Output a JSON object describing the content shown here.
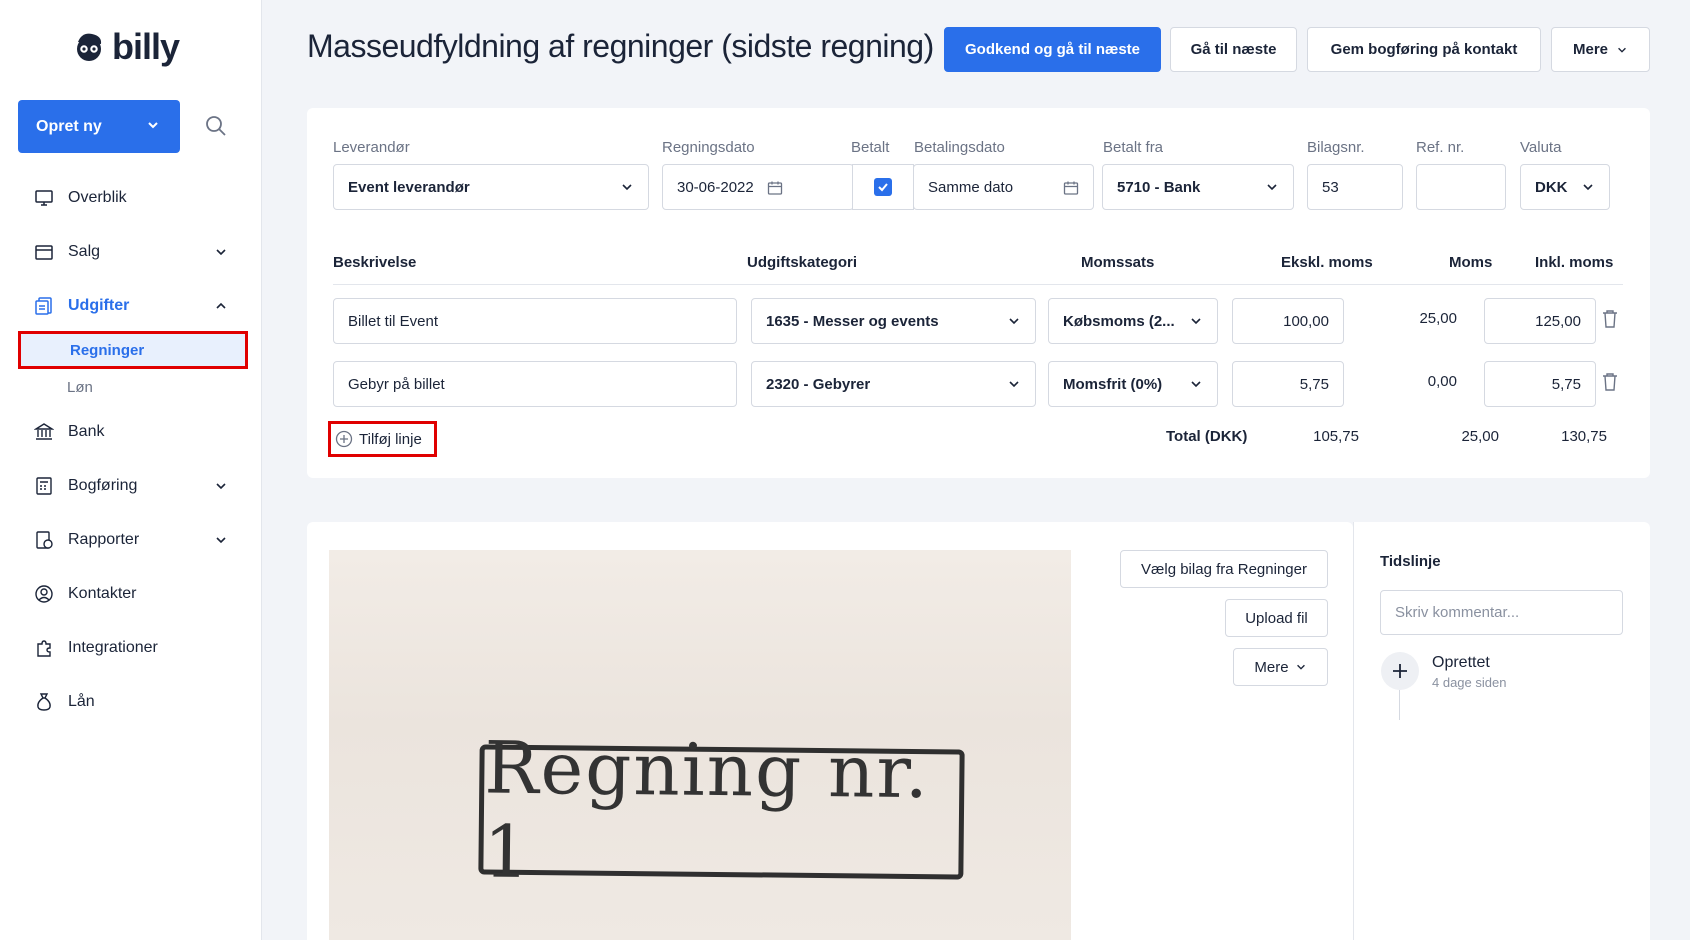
{
  "brand": {
    "name": "billy"
  },
  "sidebar": {
    "create_label": "Opret ny",
    "items": [
      {
        "label": "Overblik"
      },
      {
        "label": "Salg"
      },
      {
        "label": "Udgifter"
      },
      {
        "label": "Regninger"
      },
      {
        "label": "Løn"
      },
      {
        "label": "Bank"
      },
      {
        "label": "Bogføring"
      },
      {
        "label": "Rapporter"
      },
      {
        "label": "Kontakter"
      },
      {
        "label": "Integrationer"
      },
      {
        "label": "Lån"
      }
    ]
  },
  "header": {
    "title": "Masseudfyldning af regninger (sidste regning)",
    "approve_label": "Godkend og gå til næste",
    "next_label": "Gå til næste",
    "save_posting_label": "Gem bogføring på kontakt",
    "more_label": "Mere"
  },
  "bill": {
    "labels": {
      "supplier": "Leverandør",
      "bill_date": "Regningsdato",
      "paid": "Betalt",
      "payment_date": "Betalingsdato",
      "paid_from": "Betalt fra",
      "voucher_no": "Bilagsnr.",
      "ref_no": "Ref. nr.",
      "currency": "Valuta"
    },
    "supplier": "Event leverandør",
    "bill_date": "30-06-2022",
    "paid": true,
    "payment_date": "Samme dato",
    "paid_from": "5710 - Bank",
    "voucher_no": "53",
    "ref_no": "",
    "currency": "DKK"
  },
  "lines": {
    "headers": {
      "description": "Beskrivelse",
      "category": "Udgiftskategori",
      "vat_rate": "Momssats",
      "excl_vat": "Ekskl. moms",
      "vat": "Moms",
      "incl_vat": "Inkl. moms"
    },
    "rows": [
      {
        "description": "Billet til Event",
        "category": "1635 - Messer og events",
        "vat_rate": "Købsmoms (2...",
        "excl": "100,00",
        "vat": "25,00",
        "incl": "125,00"
      },
      {
        "description": "Gebyr på billet",
        "category": "2320 - Gebyrer",
        "vat_rate": "Momsfrit (0%)",
        "excl": "5,75",
        "vat": "0,00",
        "incl": "5,75"
      }
    ],
    "add_line_label": "Tilføj linje",
    "total_label": "Total (DKK)",
    "total_excl": "105,75",
    "total_vat": "25,00",
    "total_incl": "130,75"
  },
  "attachment": {
    "receipt_text": "Regning nr. 1",
    "choose_label": "Vælg bilag fra Regninger",
    "upload_label": "Upload fil",
    "more_label": "Mere"
  },
  "timeline": {
    "title": "Tidslinje",
    "comment_placeholder": "Skriv kommentar...",
    "event_title": "Oprettet",
    "event_time": "4 dage siden"
  },
  "colors": {
    "accent": "#2a6fea",
    "highlight": "#e00000"
  }
}
